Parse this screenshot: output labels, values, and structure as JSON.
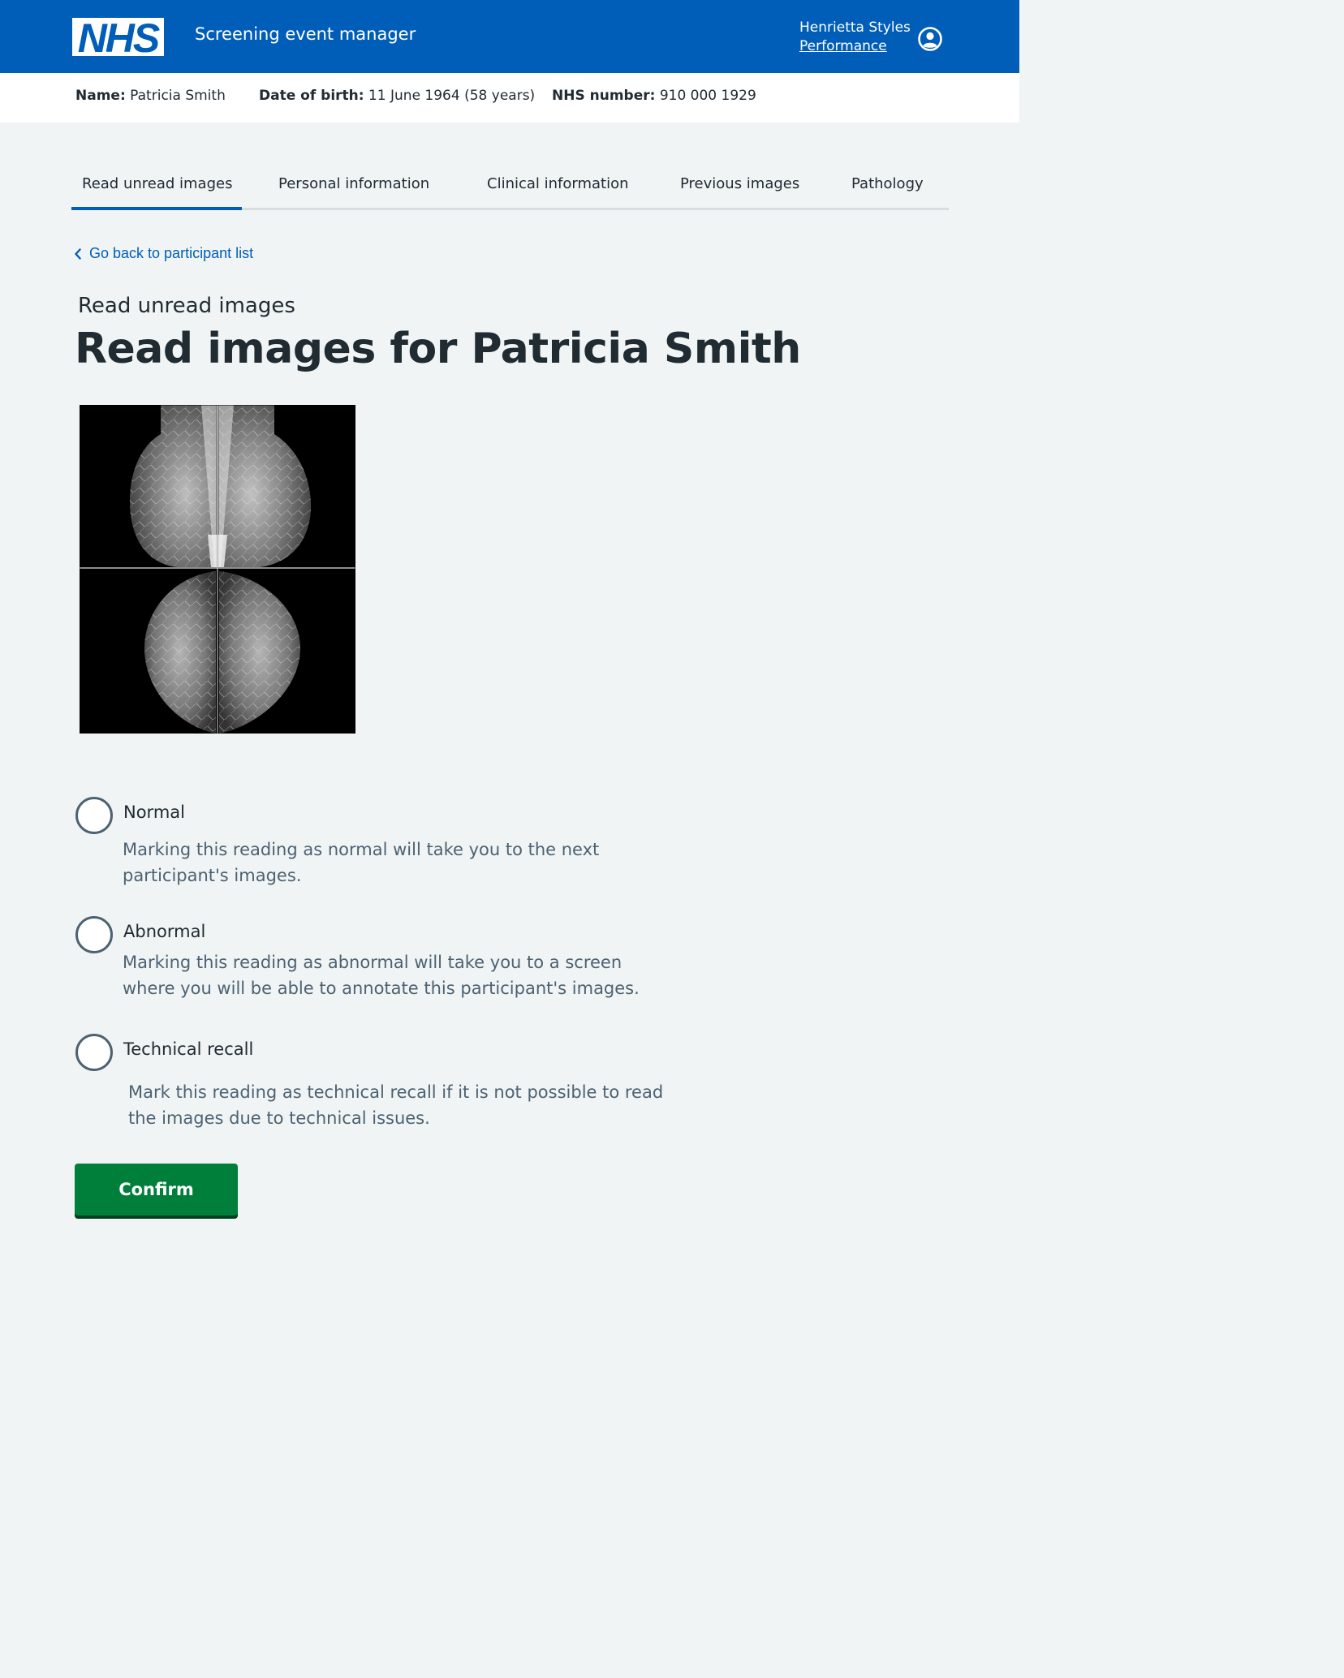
{
  "header": {
    "logo_text": "NHS",
    "service_name": "Screening event manager",
    "user_name": "Henrietta Styles",
    "user_link": "Performance",
    "user_icon": "user-circle-icon"
  },
  "patient": {
    "name_label": "Name:",
    "name_value": "Patricia Smith",
    "dob_label": "Date of birth:",
    "dob_value": "11 June 1964 (58 years)",
    "nhs_label": "NHS number:",
    "nhs_value": "910 000 1929"
  },
  "tabs": [
    {
      "label": "Read unread images",
      "active": true
    },
    {
      "label": "Personal information",
      "active": false
    },
    {
      "label": "Clinical information",
      "active": false
    },
    {
      "label": "Previous images",
      "active": false
    },
    {
      "label": "Pathology",
      "active": false
    }
  ],
  "back_link": "Go back to participant list",
  "caption": "Read unread images",
  "title": "Read images for Patricia Smith",
  "radios": [
    {
      "label": "Normal",
      "hint": "Marking this reading as normal will take you to the next participant's images.",
      "checked": false
    },
    {
      "label": "Abnormal",
      "hint": "Marking this reading as abnormal will take you to a screen where you will be able to annotate this participant's images.",
      "checked": false
    },
    {
      "label": "Technical recall",
      "hint": "Mark this reading as technical recall if it is not possible to read the images due to technical issues.",
      "checked": false
    }
  ],
  "confirm_label": "Confirm",
  "colors": {
    "nhs_blue": "#005eb8",
    "background": "#f0f4f5",
    "button_green": "#007f3b",
    "text": "#212b32",
    "secondary_text": "#4c6272"
  }
}
